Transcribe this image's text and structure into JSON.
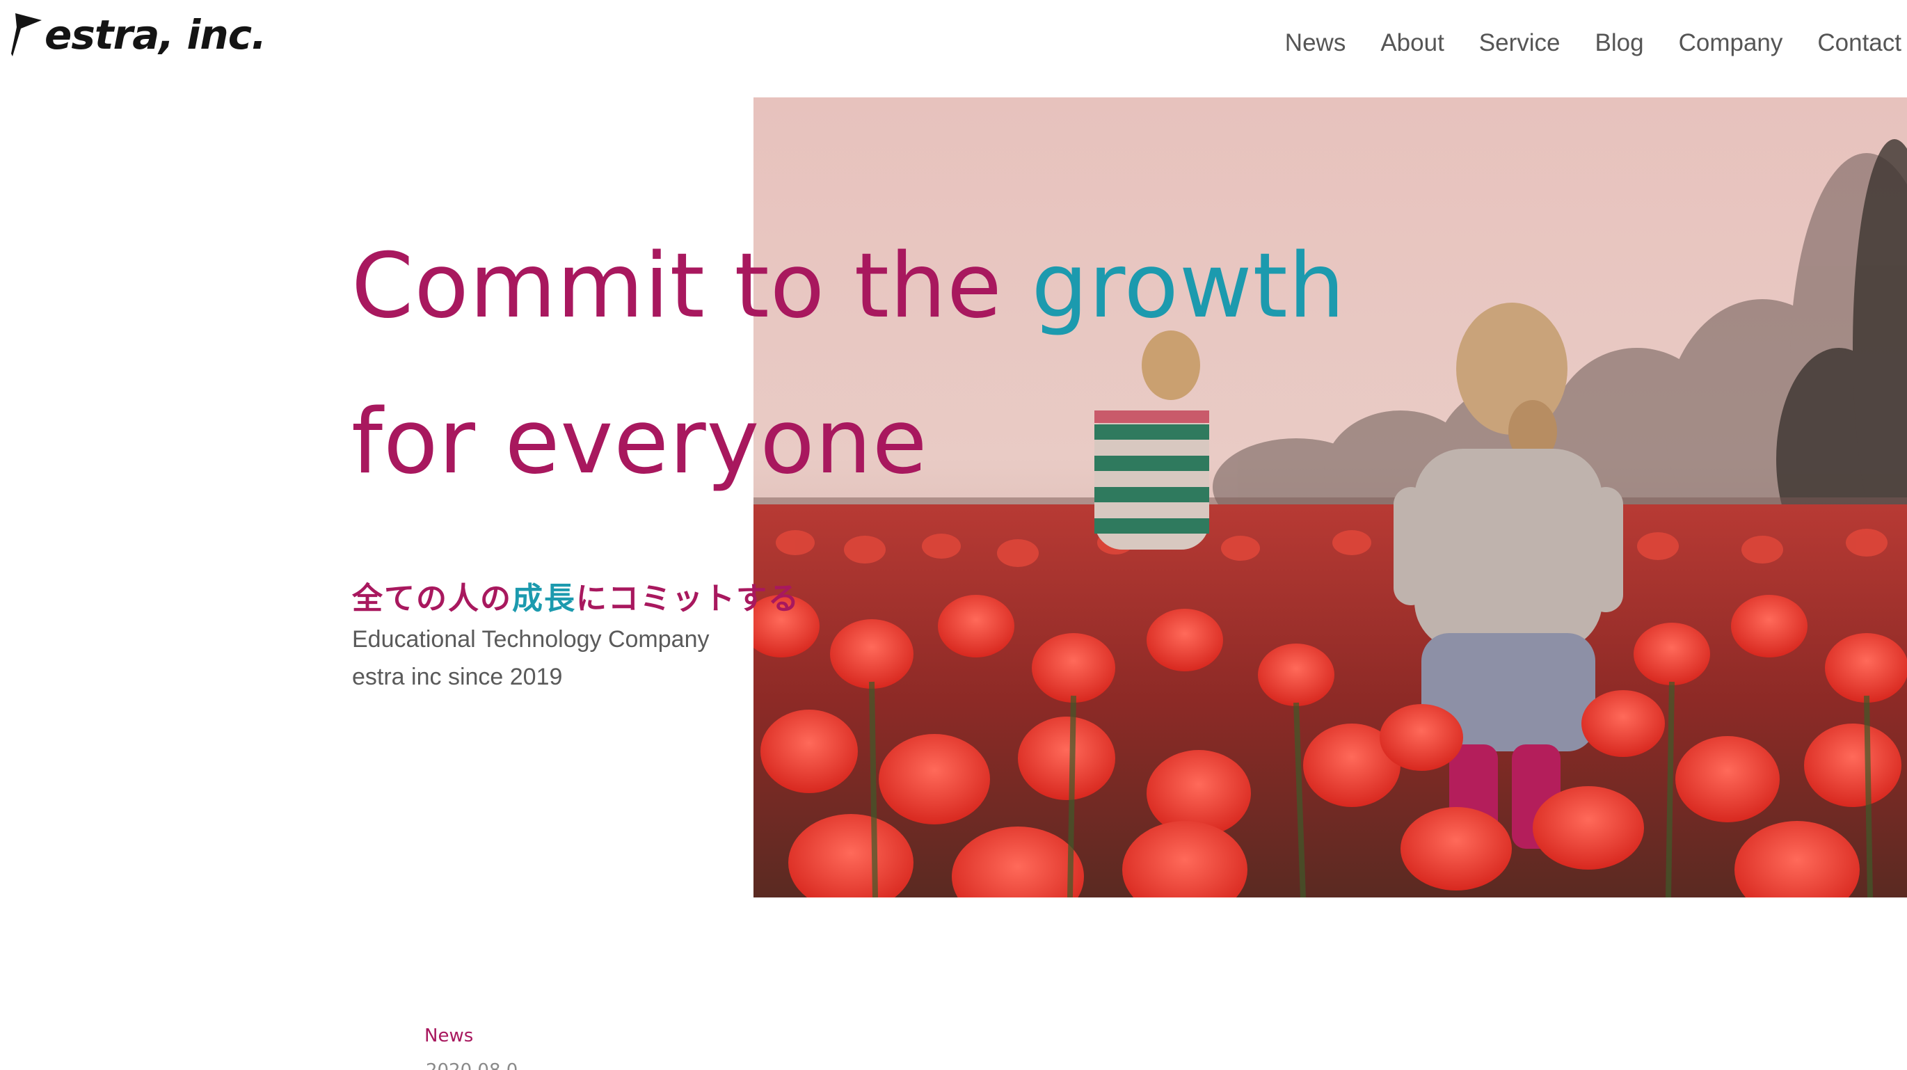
{
  "header": {
    "logo_text": "estra, inc.",
    "nav": [
      {
        "label": "News"
      },
      {
        "label": "About"
      },
      {
        "label": "Service"
      },
      {
        "label": "Blog"
      },
      {
        "label": "Company"
      },
      {
        "label": "Contact"
      }
    ]
  },
  "hero": {
    "headline": {
      "line1_part1": "Commit to the ",
      "line1_accent": "growth",
      "line2": "for everyone"
    },
    "subtitle_jp": {
      "part1": "全ての人の",
      "accent": "成長",
      "part2": "にコミットする"
    },
    "tagline": {
      "line1": "Educational Technology Company",
      "line2": "estra inc since 2019"
    },
    "image_alt": "Two children walking through a field of red tulips"
  },
  "news": {
    "label": "News",
    "first_date": "2020.08.0"
  },
  "colors": {
    "brand_magenta": "#a8185e",
    "brand_teal": "#1c9aae",
    "text_gray": "#5a5a5a"
  }
}
